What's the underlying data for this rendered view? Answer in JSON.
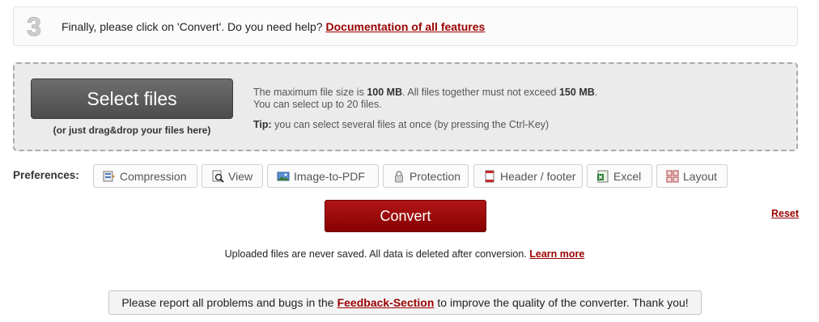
{
  "step": {
    "number": "3",
    "text": "Finally, please click on 'Convert'. Do you need help?",
    "help_link": "Documentation of all features"
  },
  "upload": {
    "select_button": "Select files",
    "drag_hint": "(or just drag&drop your files here)",
    "max_size_prefix": "The maximum file size is",
    "max_size_value": "100 MB",
    "max_total_prefix": ". All files together must not exceed",
    "max_total_value": "150 MB",
    "max_total_suffix": ".",
    "max_files": "You can select up to 20 files.",
    "tip_label": "Tip:",
    "tip_text": "you can select several files at once (by pressing the Ctrl-Key)"
  },
  "preferences": {
    "label": "Preferences:",
    "buttons": [
      {
        "label": "Compression",
        "icon": "compression-icon"
      },
      {
        "label": "View",
        "icon": "view-icon"
      },
      {
        "label": "Image-to-PDF",
        "icon": "image-icon"
      },
      {
        "label": "Protection",
        "icon": "lock-icon"
      },
      {
        "label": "Header / footer",
        "icon": "header-footer-icon"
      },
      {
        "label": "Excel",
        "icon": "excel-icon"
      },
      {
        "label": "Layout",
        "icon": "layout-icon"
      }
    ]
  },
  "actions": {
    "convert": "Convert",
    "reset": "Reset"
  },
  "privacy": {
    "text": "Uploaded files are never saved. All data is deleted after conversion.",
    "link": "Learn more"
  },
  "feedback": {
    "prefix": "Please report all problems and bugs in the",
    "link": "Feedback-Section",
    "suffix": "to improve the quality of the converter. Thank you!"
  },
  "colors": {
    "accent": "#9b0000",
    "convert_bg": "#a10d0d",
    "select_bg": "#5c5c5c"
  }
}
